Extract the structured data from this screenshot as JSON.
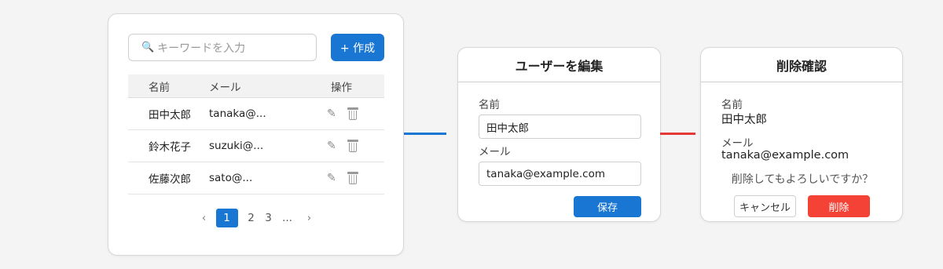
{
  "colors": {
    "accent": "#1976d2",
    "danger": "#f44336",
    "connector_red": "#e53935"
  },
  "list": {
    "search": {
      "placeholder": "キーワードを入力",
      "icon": "search-icon"
    },
    "create_button": "+ 作成",
    "headers": {
      "name": "名前",
      "mail": "メール",
      "actions": "操作"
    },
    "rows": [
      {
        "name": "田中太郎",
        "mail": "tanaka@..."
      },
      {
        "name": "鈴木花子",
        "mail": "suzuki@..."
      },
      {
        "name": "佐藤次郎",
        "mail": "sato@..."
      }
    ],
    "pagination": {
      "prev": "‹",
      "pages": [
        "1",
        "2",
        "3"
      ],
      "current": "1",
      "ellipsis": "...",
      "next": "›"
    }
  },
  "edit_dialog": {
    "title": "ユーザーを編集",
    "name_label": "名前",
    "name_value": "田中太郎",
    "mail_label": "メール",
    "mail_value": "tanaka@example.com",
    "save_button": "保存"
  },
  "delete_dialog": {
    "title": "削除確認",
    "name_label": "名前",
    "name_value": "田中太郎",
    "mail_label": "メール",
    "mail_value": "tanaka@example.com",
    "confirm_text": "削除してもよろしいですか？",
    "cancel_button": "キャンセル",
    "delete_button": "削除"
  }
}
